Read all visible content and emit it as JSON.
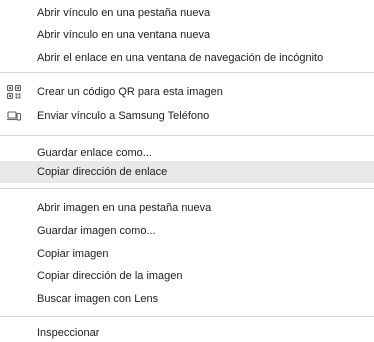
{
  "menu": {
    "group1": [
      {
        "label": "Abrir vínculo en una pestaña nueva"
      },
      {
        "label": "Abrir vínculo en una ventana nueva"
      },
      {
        "label": "Abrir el enlace en una ventana de navegación de incógnito"
      }
    ],
    "group2": [
      {
        "label": "Crear un código QR para esta imagen",
        "icon": "qr-code-icon"
      },
      {
        "label": "Enviar vínculo a Samsung Teléfono",
        "icon": "send-to-device-icon"
      }
    ],
    "group3": [
      {
        "label": "Guardar enlace como..."
      },
      {
        "label": "Copiar dirección de enlace",
        "highlighted": true
      }
    ],
    "group4": [
      {
        "label": "Abrir imagen en una pestaña nueva"
      },
      {
        "label": "Guardar imagen como..."
      },
      {
        "label": "Copiar imagen"
      },
      {
        "label": "Copiar dirección de la imagen"
      },
      {
        "label": "Buscar imagen con Lens"
      }
    ],
    "group5": [
      {
        "label": "Inspeccionar"
      }
    ]
  },
  "colors": {
    "text": "#202124",
    "separator": "#d7d7d7",
    "highlight": "#e8e8e8",
    "icon": "#5f6368"
  }
}
